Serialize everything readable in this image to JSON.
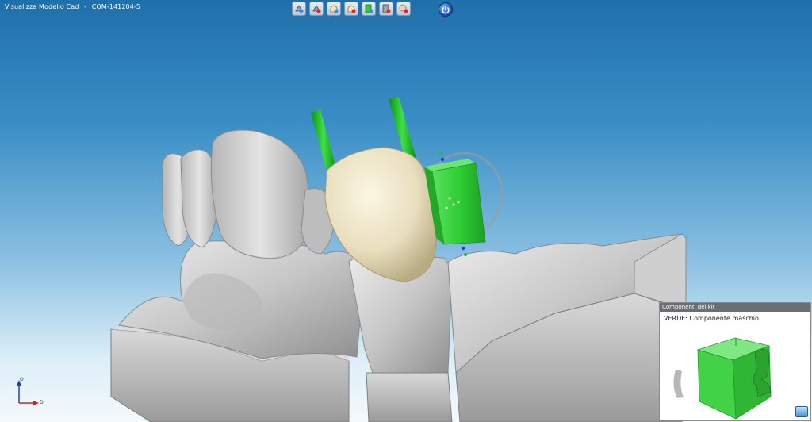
{
  "window": {
    "title": "Visualizza Modello Cad",
    "separator": "-",
    "document_id": "COM-141204-5"
  },
  "toolbar": {
    "buttons": [
      {
        "name": "view-model-icon"
      },
      {
        "name": "hide-model-icon"
      },
      {
        "name": "show-crown-icon"
      },
      {
        "name": "hide-crown-icon"
      },
      {
        "name": "show-kit-icon"
      },
      {
        "name": "hide-kit-icon"
      },
      {
        "name": "remove-antagonist-icon"
      }
    ],
    "power": {
      "name": "power-icon"
    }
  },
  "axis": {
    "up_label": "O",
    "right_label": "D"
  },
  "kit_panel": {
    "header": "Componenti del kit",
    "description": "VERDE: Componente maschio."
  },
  "colors": {
    "background_top": "#1f6fab",
    "background_bottom": "#f4f9fc",
    "component_green": "#34d33a",
    "crown": "#ede5c8",
    "model_gray": "#c9c9c9"
  }
}
